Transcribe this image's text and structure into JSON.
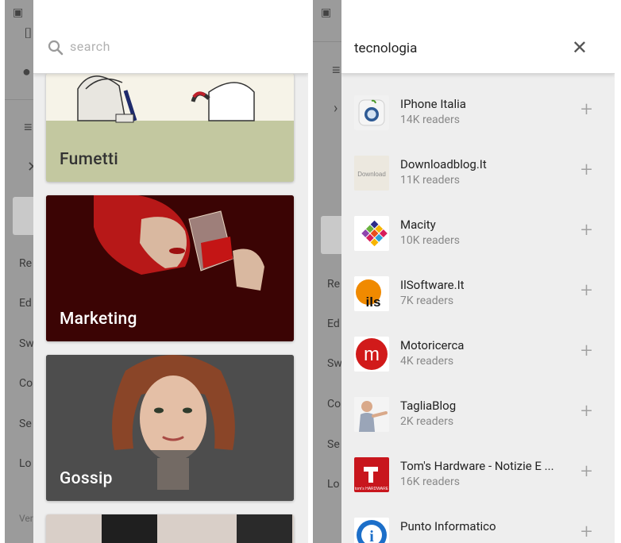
{
  "left": {
    "search": {
      "placeholder": "search"
    },
    "background_menu": [
      "Re",
      "Ed",
      "Sw",
      "Co",
      "Se",
      "Lo",
      "Ver"
    ],
    "categories": [
      {
        "title": "Fumetti"
      },
      {
        "title": "Marketing"
      },
      {
        "title": "Gossip"
      }
    ]
  },
  "right": {
    "search": {
      "query": "tecnologia"
    },
    "background_menu": [
      "Re",
      "Ed",
      "Sw",
      "Co",
      "Se",
      "Lo"
    ],
    "feeds": [
      {
        "name": "IPhone Italia",
        "readers": "14K readers",
        "icon": "iphone-italia-logo"
      },
      {
        "name": "Downloadblog.It",
        "readers": "11K readers",
        "icon": "downloadblog-logo",
        "logo_text": "Download"
      },
      {
        "name": "Macity",
        "readers": "10K readers",
        "icon": "macity-logo"
      },
      {
        "name": "IlSoftware.It",
        "readers": "7K readers",
        "icon": "ilsoftware-logo",
        "logo_text": "ils"
      },
      {
        "name": "Motoricerca",
        "readers": "4K readers",
        "icon": "motoricerca-logo",
        "logo_text": "m"
      },
      {
        "name": "TagliaBlog",
        "readers": "2K readers",
        "icon": "tagliablog-logo"
      },
      {
        "name": "Tom's Hardware - Notizie E ...",
        "readers": "16K readers",
        "icon": "toms-hardware-logo",
        "logo_text": "tom's HARDWARE"
      },
      {
        "name": "Punto Informatico",
        "readers": "",
        "icon": "punto-informatico-logo",
        "logo_text": "i"
      }
    ]
  },
  "colors": {
    "drawer_bg": "#eeeeee",
    "underlay": "#9b9b9b",
    "marketing_card": "#3b0404",
    "fumetti_card": "#c3c8a0",
    "gossip_card": "#4a4a4a"
  }
}
